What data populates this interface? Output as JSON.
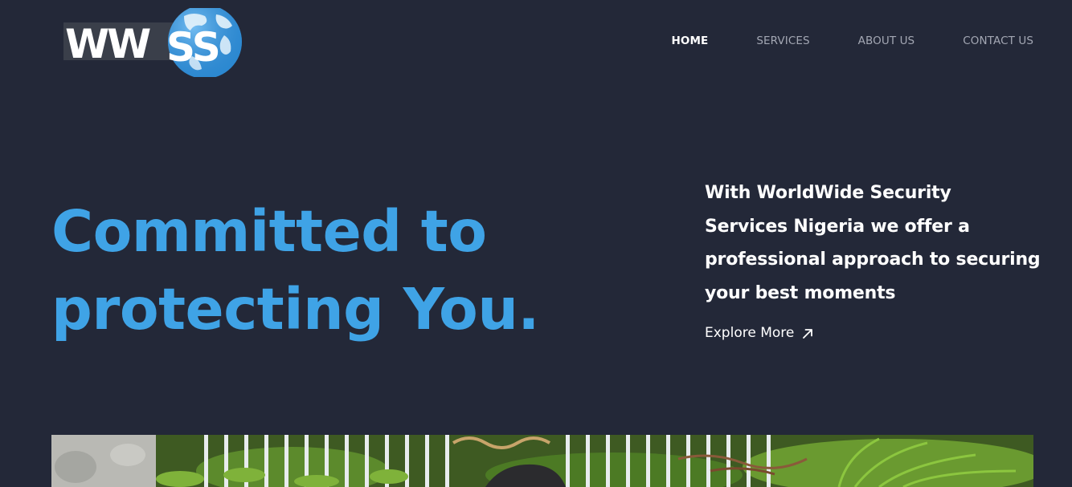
{
  "brand": {
    "logo_text": "WWSS",
    "colors": {
      "background": "#232838",
      "accent": "#3fa3e6",
      "globe": "#2f8fd8"
    }
  },
  "nav": {
    "items": [
      {
        "label": "HOME",
        "active": true
      },
      {
        "label": "SERVICES",
        "active": false
      },
      {
        "label": "ABOUT US",
        "active": false
      },
      {
        "label": "CONTACT US",
        "active": false
      }
    ]
  },
  "hero": {
    "title_lines": [
      "Committed to",
      "protecting You."
    ],
    "description_lines": [
      "With WorldWide Security",
      "Services Nigeria we offer a",
      "professional approach to securing",
      "your best moments"
    ],
    "cta_label": "Explore More",
    "cta_icon": "arrow-up-right-icon"
  },
  "photo": {
    "subject": "garden-photo"
  }
}
